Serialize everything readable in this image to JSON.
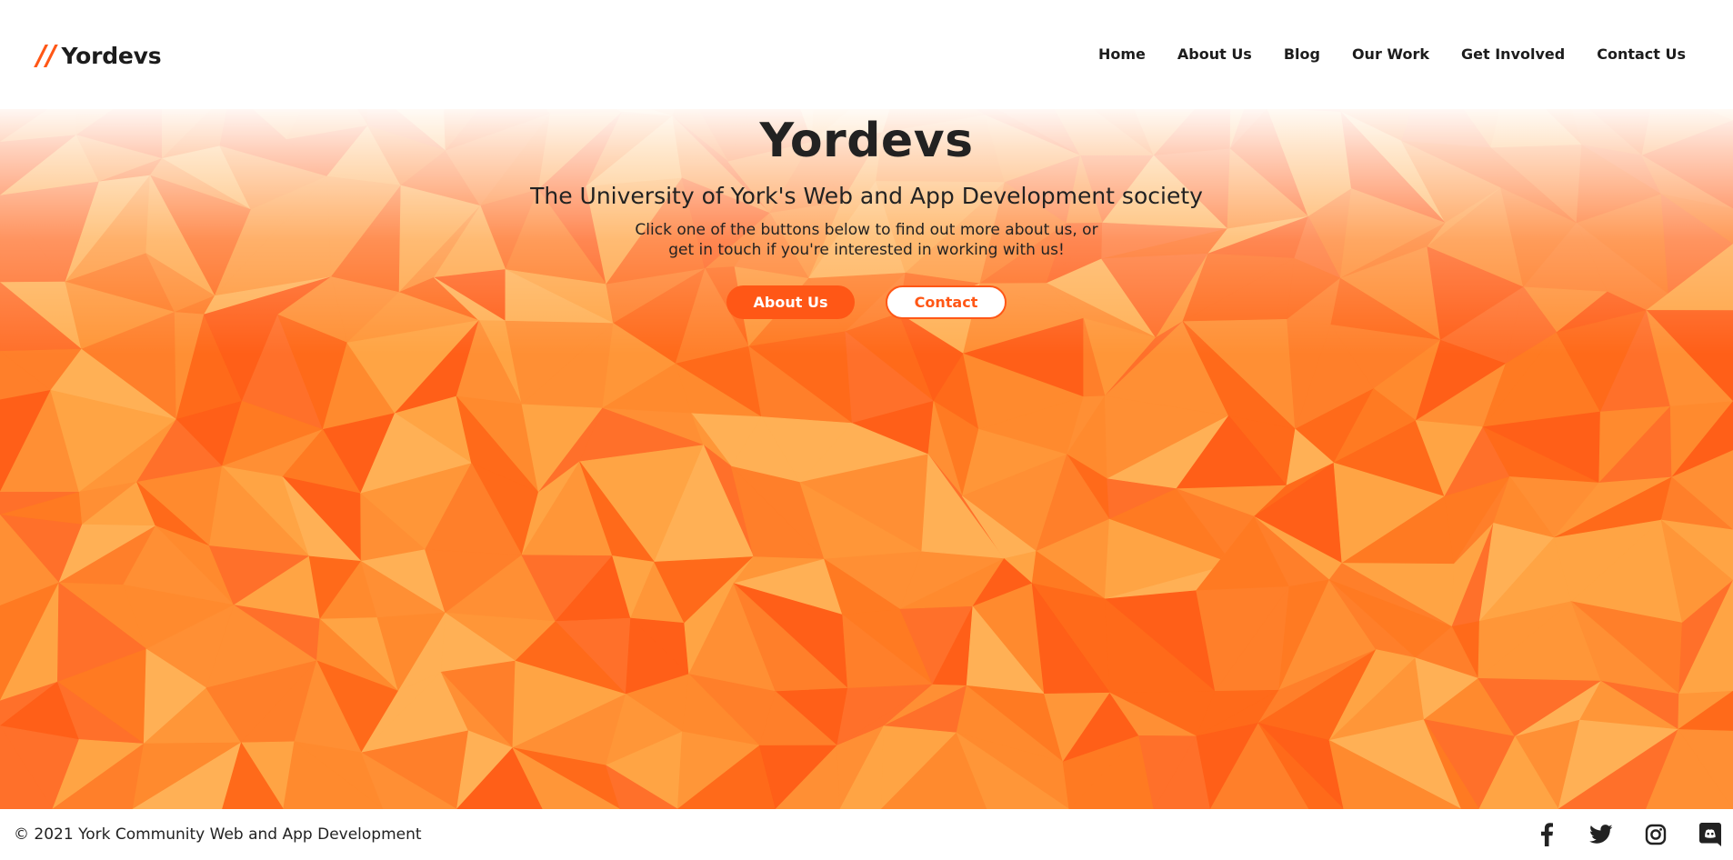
{
  "brand": {
    "slashes": "//",
    "name": "Yordevs",
    "accent_color": "#ff5716"
  },
  "nav": {
    "items": [
      {
        "label": "Home"
      },
      {
        "label": "About Us"
      },
      {
        "label": "Blog"
      },
      {
        "label": "Our Work"
      },
      {
        "label": "Get Involved"
      },
      {
        "label": "Contact Us"
      }
    ]
  },
  "hero": {
    "title": "Yordevs",
    "subtitle": "The University of York's Web and App Development society",
    "description": "Click one of the buttons below to find out more about us, or get in touch if you're interested in working with us!",
    "primary_button": "About Us",
    "secondary_button": "Contact"
  },
  "footer": {
    "copyright": "© 2021 York Community Web and App Development",
    "social_icons": [
      "facebook-icon",
      "twitter-icon",
      "instagram-icon",
      "discord-icon"
    ]
  }
}
